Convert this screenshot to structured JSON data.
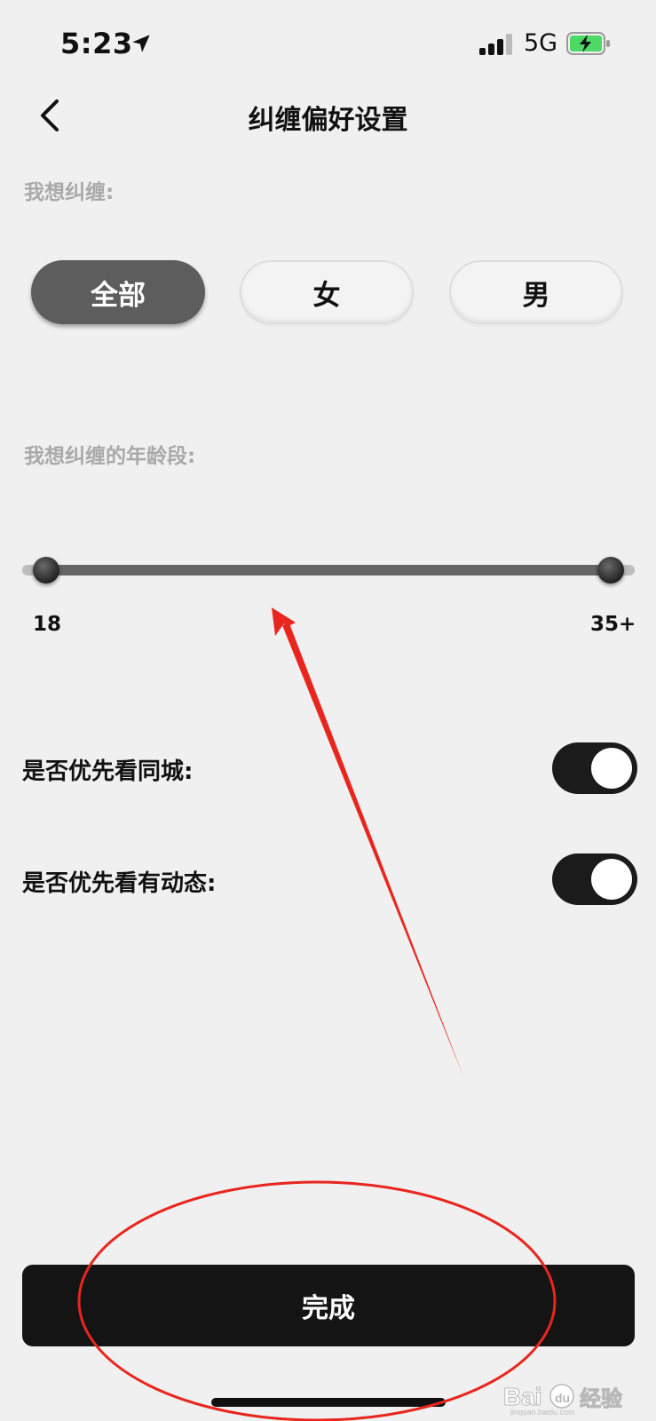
{
  "status_bar": {
    "time": "5:23",
    "network": "5G",
    "icons": [
      "location-arrow-icon",
      "signal-bars-icon",
      "battery-charging-icon"
    ],
    "battery_color": "#4cd964"
  },
  "header": {
    "title": "纠缠偏好设置",
    "back_icon": "chevron-left-icon"
  },
  "gender_section": {
    "label": "我想纠缠:",
    "options": [
      "全部",
      "女",
      "男"
    ],
    "selected": "全部"
  },
  "age_section": {
    "label": "我想纠缠的年龄段:",
    "min_label": "18",
    "max_label": "35+",
    "selected_range": [
      18,
      35
    ]
  },
  "toggles": [
    {
      "label": "是否优先看同城:",
      "on": true
    },
    {
      "label": "是否优先看有动态:",
      "on": true
    }
  ],
  "done_button": {
    "label": "完成"
  },
  "annotation": {
    "color": "#e8261e",
    "shapes": [
      "arrow",
      "ellipse"
    ]
  },
  "watermark": {
    "brand": "Baidu",
    "suffix": "经验",
    "domain": "jingyan.baidu.com"
  },
  "colors": {
    "background": "#f0f0f0",
    "selected_pill": "#5d5d5d",
    "toggle_on": "#1b1b1b",
    "primary_button": "#141414",
    "label_gray": "#a9a9a9"
  }
}
